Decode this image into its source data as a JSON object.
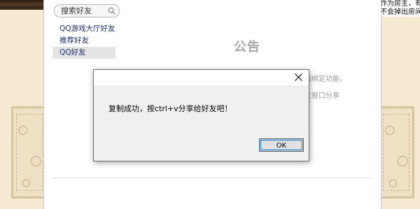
{
  "background_page": {
    "right_text": [
      "作为房主，有",
      "不会掉出房间"
    ]
  },
  "friends_panel": {
    "search_placeholder": "搜索好友",
    "items": [
      {
        "label": "QQ游戏大厅好友",
        "selected": false
      },
      {
        "label": "推荐好友",
        "selected": false
      },
      {
        "label": "QQ好友",
        "selected": true
      }
    ]
  },
  "announcement": {
    "title": "公告",
    "partial_lines": [
      "的绑定功能，",
      "天窗口分享",
      "。"
    ]
  },
  "dialog": {
    "message": "复制成功，按ctrl+v分享给好友吧！",
    "ok_label": "OK"
  },
  "colors": {
    "page_bg": "#f6ead2",
    "link_blue": "#1a2f6b",
    "selected_bg": "#e4e4e4",
    "focus_blue": "#0078d7"
  }
}
